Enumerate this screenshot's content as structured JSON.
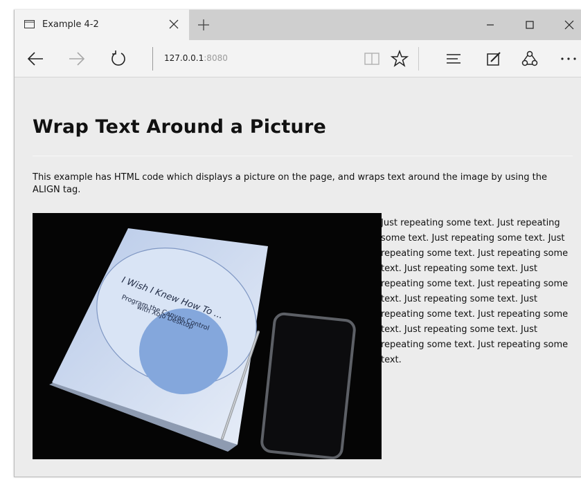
{
  "tab": {
    "title": "Example 4-2",
    "icon": "page-icon",
    "close_icon": "close-icon",
    "new_tab_icon": "plus-icon"
  },
  "window_controls": [
    "minimize-icon",
    "maximize-icon",
    "close-icon"
  ],
  "nav": {
    "back_icon": "arrow-left-icon",
    "forward_icon": "arrow-right-icon",
    "refresh_icon": "refresh-icon",
    "address_host": "127.0.0.1",
    "address_port": ":8080",
    "tools": [
      "reading-view-icon",
      "favorite-star-icon",
      "hub-icon",
      "web-note-icon",
      "share-icon",
      "more-icon"
    ]
  },
  "page": {
    "title": "Wrap Text Around a Picture",
    "intro": "This example has HTML code which displays a picture on the page, and wraps text around the image by using the ALIGN tag.",
    "wrapped_text": "Just repeating some text. Just repeating some text. Just repeating some text. Just repeating some text. Just repeating some text. Just repeating some text. Just repeating some text. Just repeating some text. Just repeating some text. Just repeating some text. Just repeating some text. Just repeating some text. Just repeating some text. Just repeating some text.",
    "image": {
      "book_title": "I Wish I Knew How To ...",
      "book_subtitle_1": "Program the Canvas Control",
      "book_subtitle_2": "with Xojo Desktop"
    }
  },
  "colors": {
    "tabbar_bg": "#cfcfcf",
    "toolbar_bg": "#f3f3f3",
    "content_bg": "#ececec",
    "image_bg": "#050505"
  }
}
